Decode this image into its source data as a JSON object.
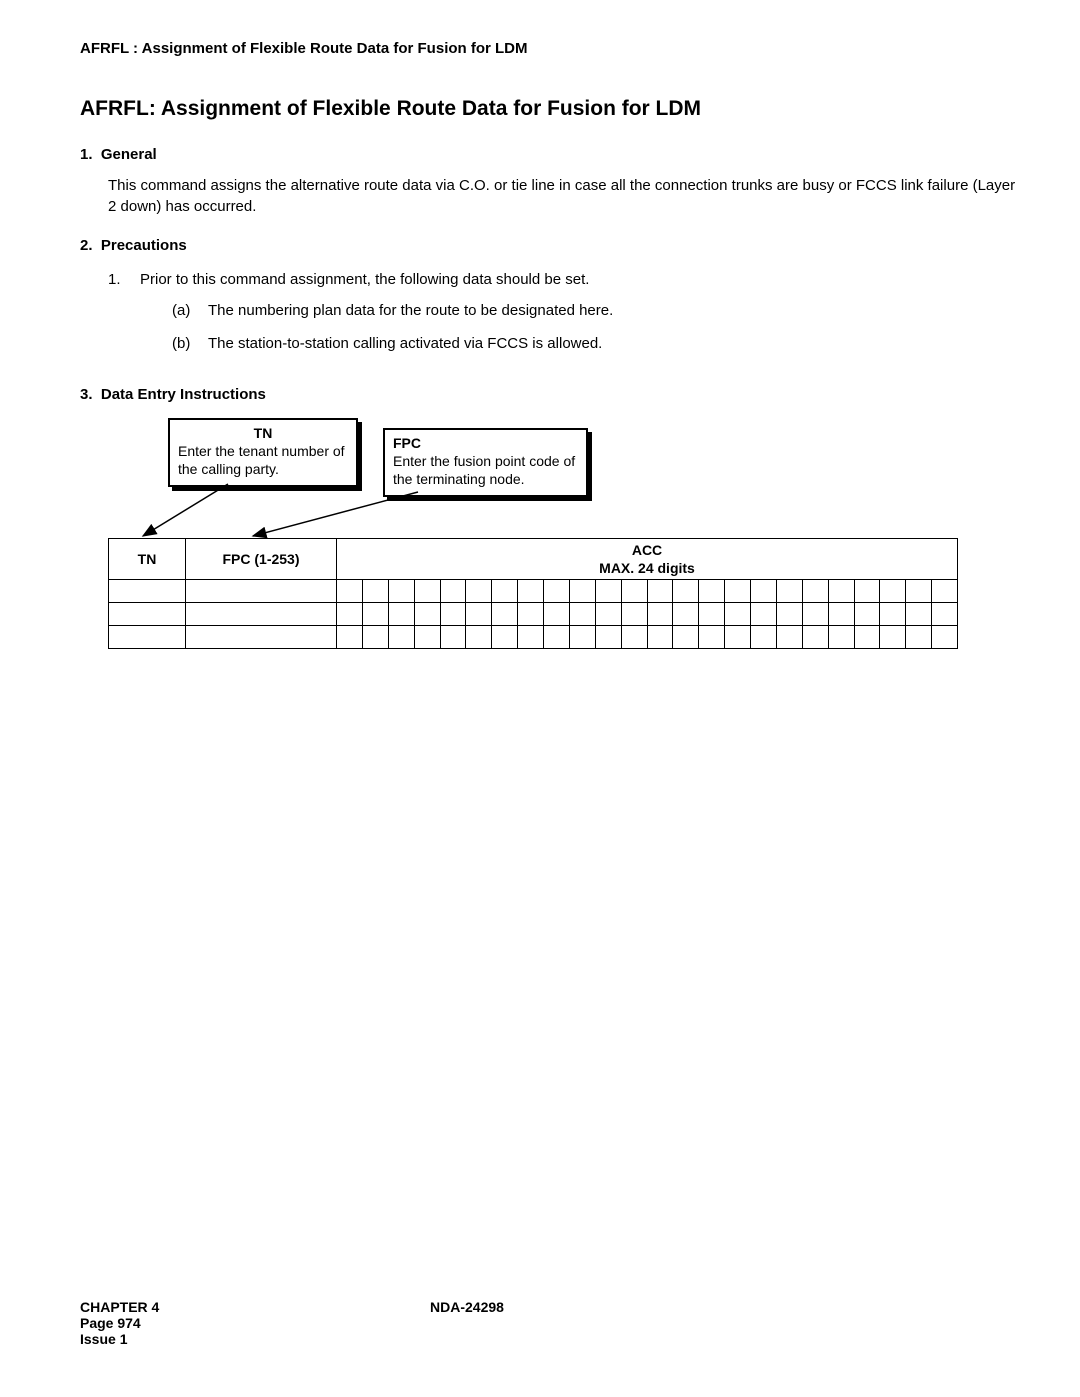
{
  "header": "AFRFL : Assignment of Flexible Route Data for Fusion for LDM",
  "title": "AFRFL: Assignment of Flexible Route Data for Fusion for LDM",
  "sections": {
    "s1": {
      "num": "1.",
      "heading": "General",
      "body": "This command assigns the alternative route data via C.O. or tie line in case all the connection trunks are busy or FCCS link failure (Layer 2 down) has occurred."
    },
    "s2": {
      "num": "2.",
      "heading": "Precautions",
      "item1_num": "1.",
      "item1_text": "Prior to this command assignment, the following data should be set.",
      "sub_a_mark": "(a)",
      "sub_a_text": "The numbering plan data for the route to be designated here.",
      "sub_b_mark": "(b)",
      "sub_b_text": "The station-to-station calling activated via FCCS is allowed."
    },
    "s3": {
      "num": "3.",
      "heading": "Data Entry Instructions"
    }
  },
  "callouts": {
    "tn": {
      "title": "TN",
      "text": "Enter the tenant number of the calling party."
    },
    "fpc": {
      "title": "FPC",
      "text": "Enter the fusion point code of the terminating node."
    }
  },
  "table": {
    "th_tn": "TN",
    "th_fpc": "FPC (1-253)",
    "th_acc": "ACC",
    "th_acc_sub": "MAX. 24 digits",
    "acc_cols": 24,
    "rows": 3
  },
  "footer": {
    "chapter": "CHAPTER 4",
    "doc": "NDA-24298",
    "page": "Page 974",
    "issue": "Issue 1"
  }
}
